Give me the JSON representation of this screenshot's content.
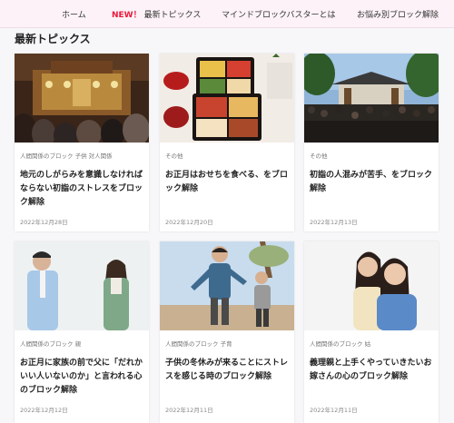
{
  "nav": {
    "items": [
      "ホーム",
      "最新トピックス",
      "マインドブロックバスターとは",
      "お悩み別ブロック解除"
    ],
    "new_badge": "NEW！"
  },
  "section_title": "最新トピックス",
  "cards": [
    {
      "category": "人間関係のブロック 子供 対人関係",
      "title": "地元のしがらみを意識しなければならない初詣のストレスをブロック解除",
      "date": "2022年12月28日",
      "image": "shrine-interior-crowd"
    },
    {
      "category": "その他",
      "title": "お正月はおせちを食べる、をブロック解除",
      "date": "2022年12月20日",
      "image": "osechi-food-box"
    },
    {
      "category": "その他",
      "title": "初詣の人混みが苦手、をブロック解除",
      "date": "2022年12月13日",
      "image": "shrine-crowd-outdoor"
    },
    {
      "category": "人間関係のブロック 親",
      "title": "お正月に家族の前で父に「だれかいい人いないのか」と言われる心のブロック解除",
      "date": "2022年12月12日",
      "image": "man-and-woman"
    },
    {
      "category": "人間関係のブロック 子育",
      "title": "子供の冬休みが来ることにストレスを感じる時のブロック解除",
      "date": "2022年12月11日",
      "image": "children-running"
    },
    {
      "category": "人間関係のブロック 姑",
      "title": "義理親と上手くやっていきたいお嫁さんの心のブロック解除",
      "date": "2022年12月11日",
      "image": "two-women-smiling"
    }
  ]
}
